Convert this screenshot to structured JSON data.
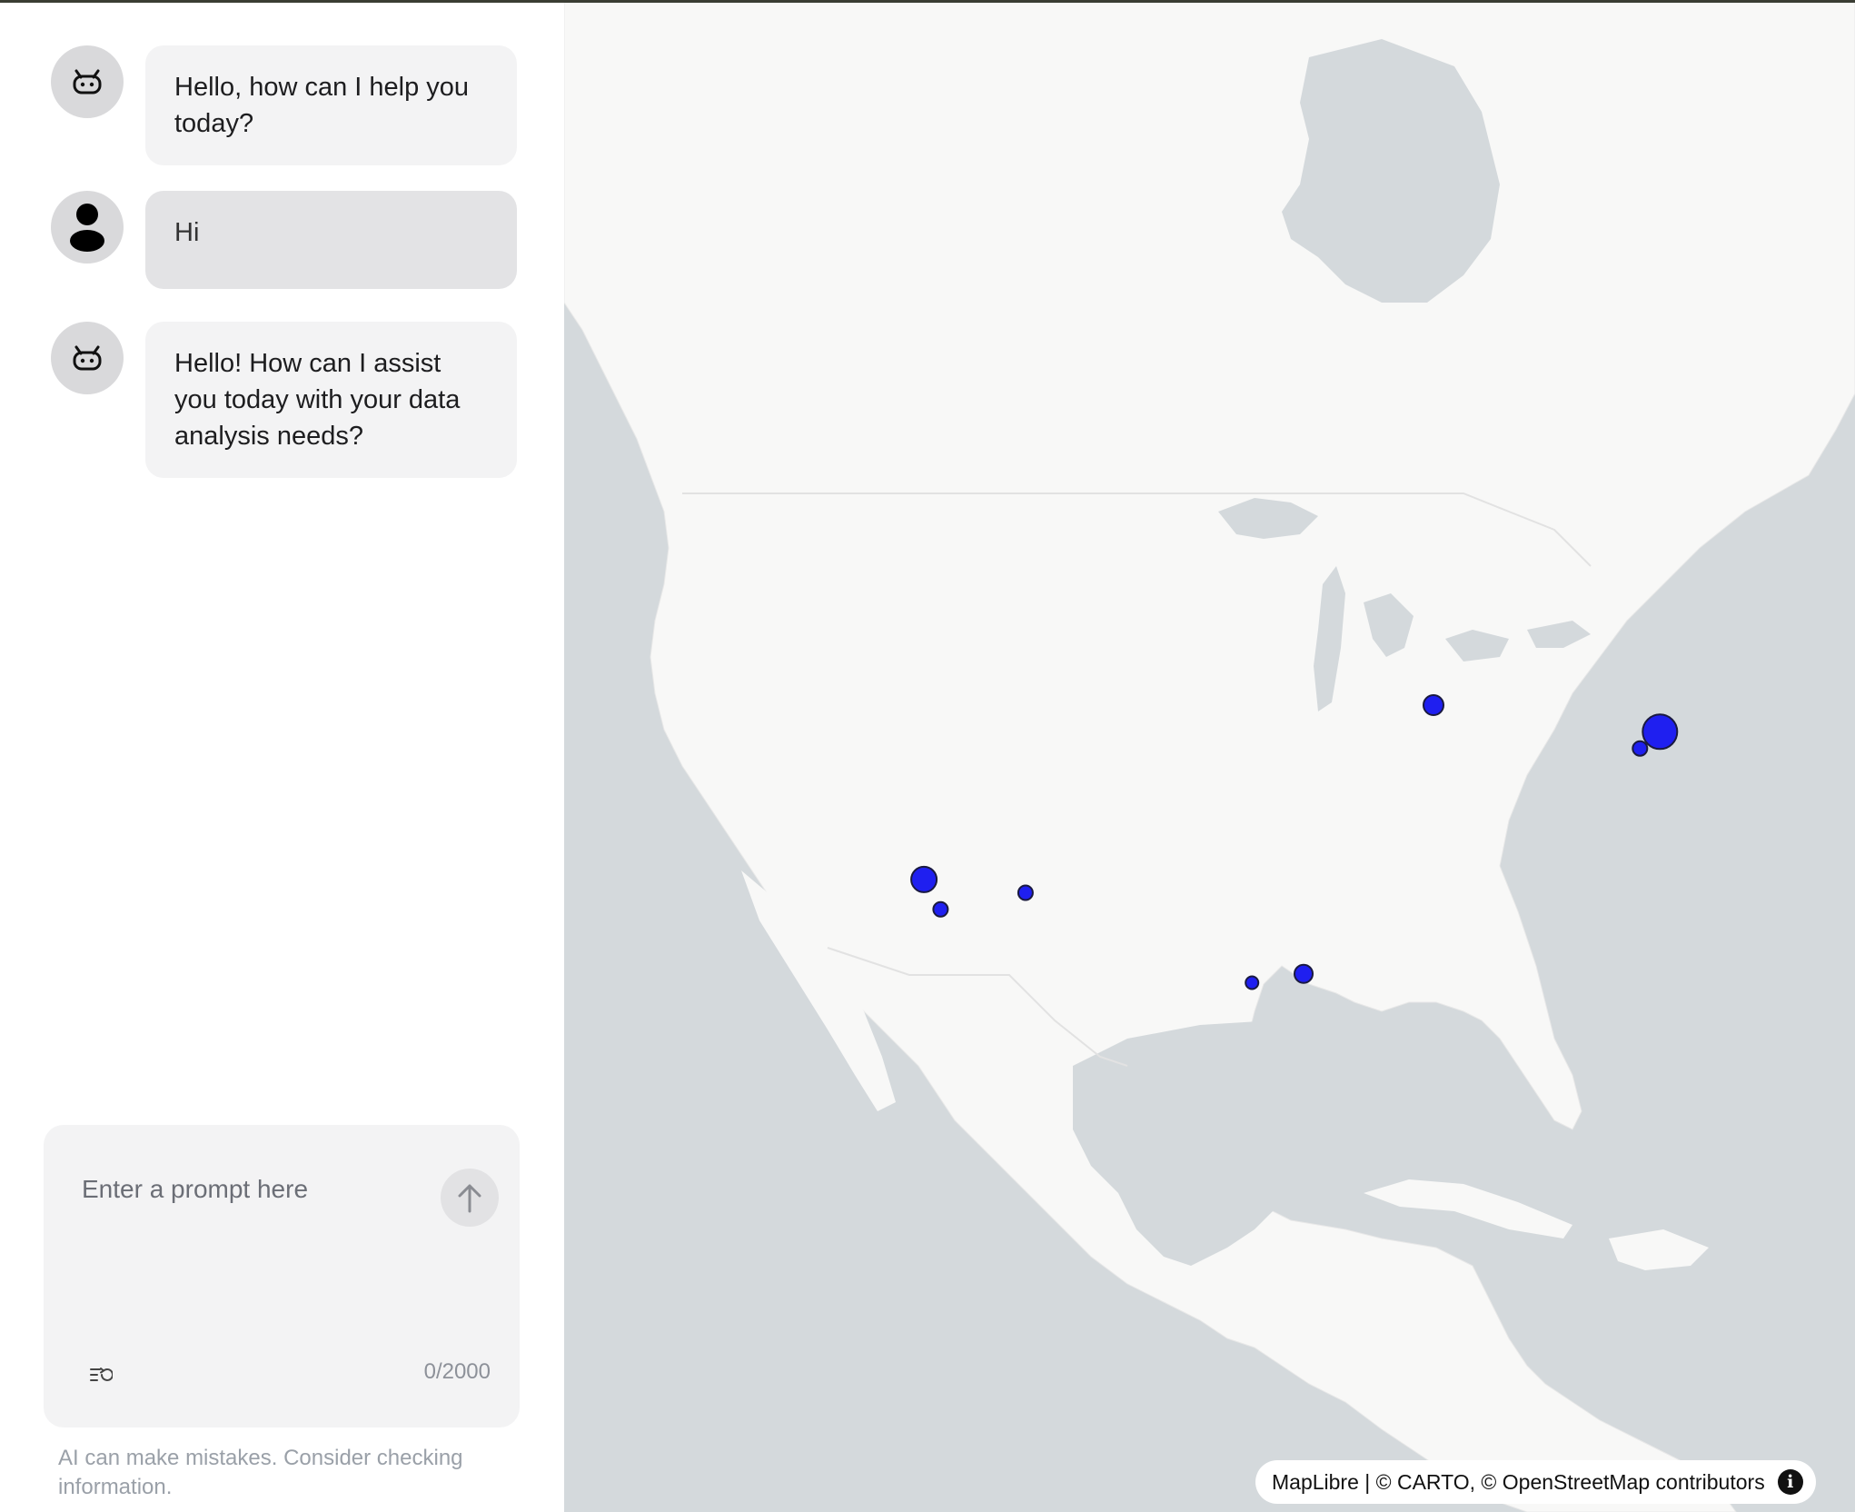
{
  "chat": {
    "messages": [
      {
        "role": "assistant",
        "avatar": "robot-icon",
        "text": "Hello, how can I help you today?"
      },
      {
        "role": "user",
        "avatar": "user-icon",
        "text": "Hi"
      },
      {
        "role": "assistant",
        "avatar": "robot-icon",
        "text": "Hello! How can I assist you today with your data analysis needs?"
      }
    ],
    "composer": {
      "placeholder": "Enter a prompt here",
      "value": "",
      "char_count": "0/2000",
      "send_icon": "arrow-up-icon",
      "history_icon": "prompt-history-icon"
    },
    "disclaimer": "AI can make mistakes. Consider checking information."
  },
  "map": {
    "attribution": "MapLibre | © CARTO, © OpenStreetMap contributors",
    "info_icon": "info-icon",
    "marker_color": "#1f1ff0",
    "markers": [
      {
        "lon": -87.6,
        "lat": 41.9,
        "size": "medium"
      },
      {
        "lon": -74.0,
        "lat": 40.7,
        "size": "large"
      },
      {
        "lon": -75.2,
        "lat": 39.95,
        "size": "small"
      },
      {
        "lon": -118.2,
        "lat": 34.05,
        "size": "large-medium"
      },
      {
        "lon": -117.2,
        "lat": 32.7,
        "size": "small"
      },
      {
        "lon": -112.1,
        "lat": 33.45,
        "size": "small"
      },
      {
        "lon": -98.5,
        "lat": 29.4,
        "size": "tiny"
      },
      {
        "lon": -95.4,
        "lat": 29.8,
        "size": "medium-small"
      }
    ]
  }
}
